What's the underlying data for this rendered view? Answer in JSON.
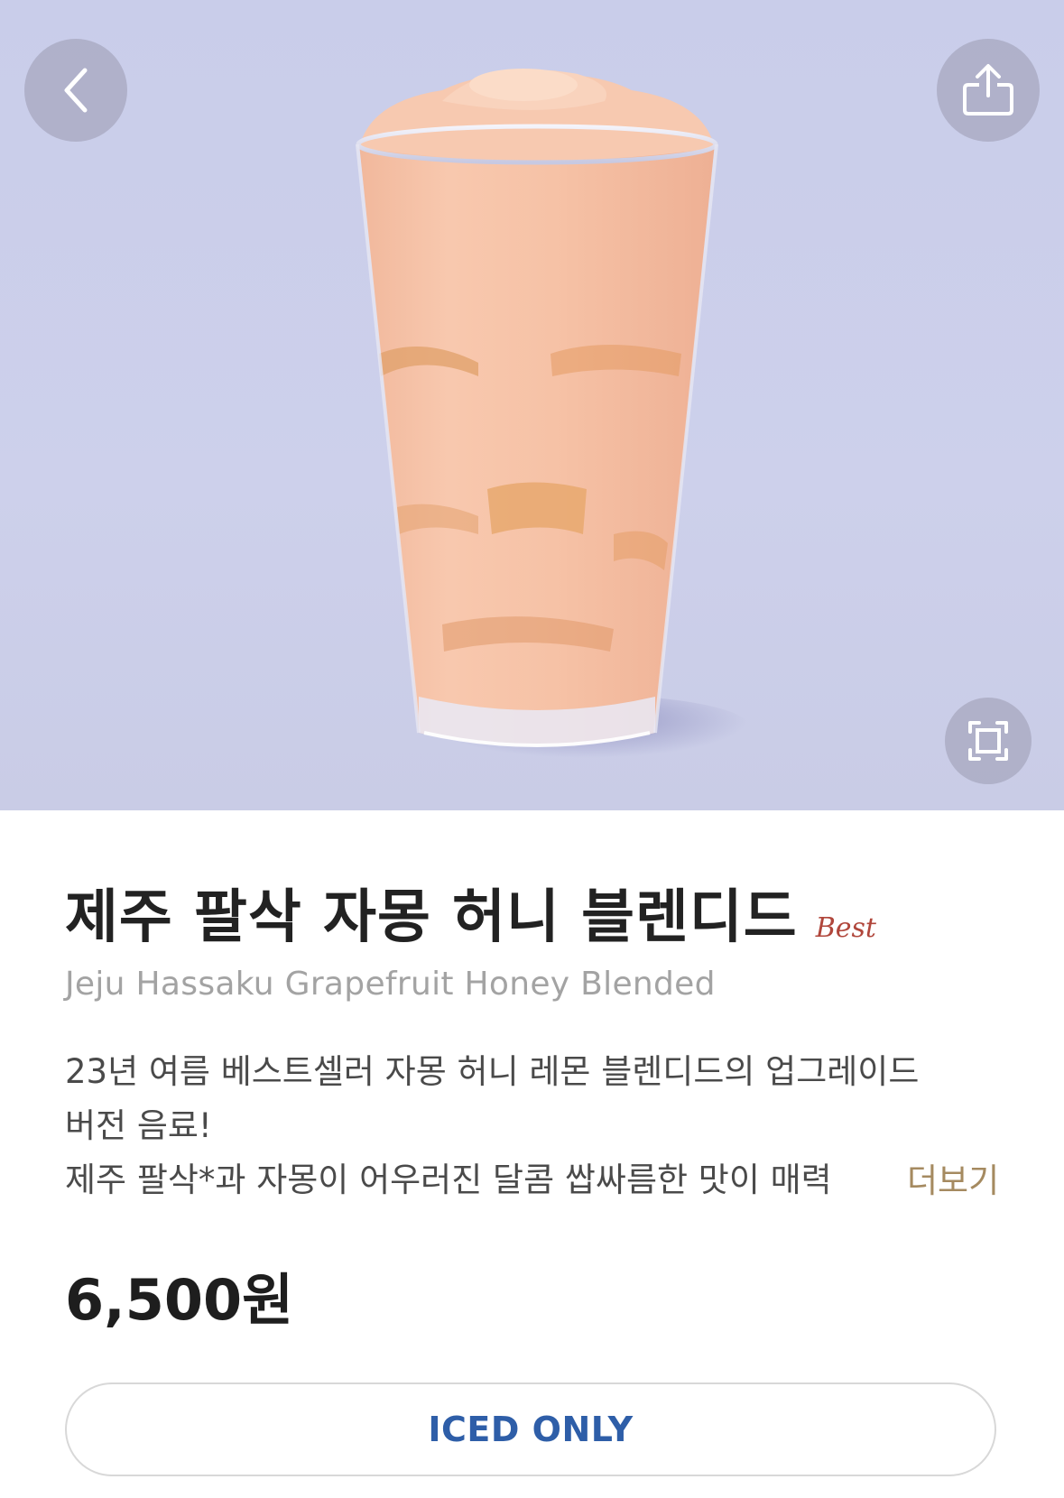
{
  "header": {
    "back_icon": "chevron-left-icon",
    "share_icon": "share-icon",
    "expand_icon": "expand-icon"
  },
  "product": {
    "name_ko": "제주 팔삭 자몽 허니 블렌디드",
    "badge": "Best",
    "name_en": "Jeju Hassaku Grapefruit Honey Blended",
    "description_lines": [
      "23년 여름 베스트셀러 자몽 허니 레몬 블렌디드의 업그레이드",
      "버전 음료!",
      "제주 팔삭*과 자몽이 어우러진 달콤 쌉싸름한 맛이 매력"
    ],
    "more_label": "더보기",
    "price": "6,500원",
    "temperature_option": "ICED ONLY"
  },
  "colors": {
    "hero_bg": "#cdd0eb",
    "badge": "#b0463b",
    "more_link": "#a58a60",
    "option_text": "#2e5ea8"
  }
}
